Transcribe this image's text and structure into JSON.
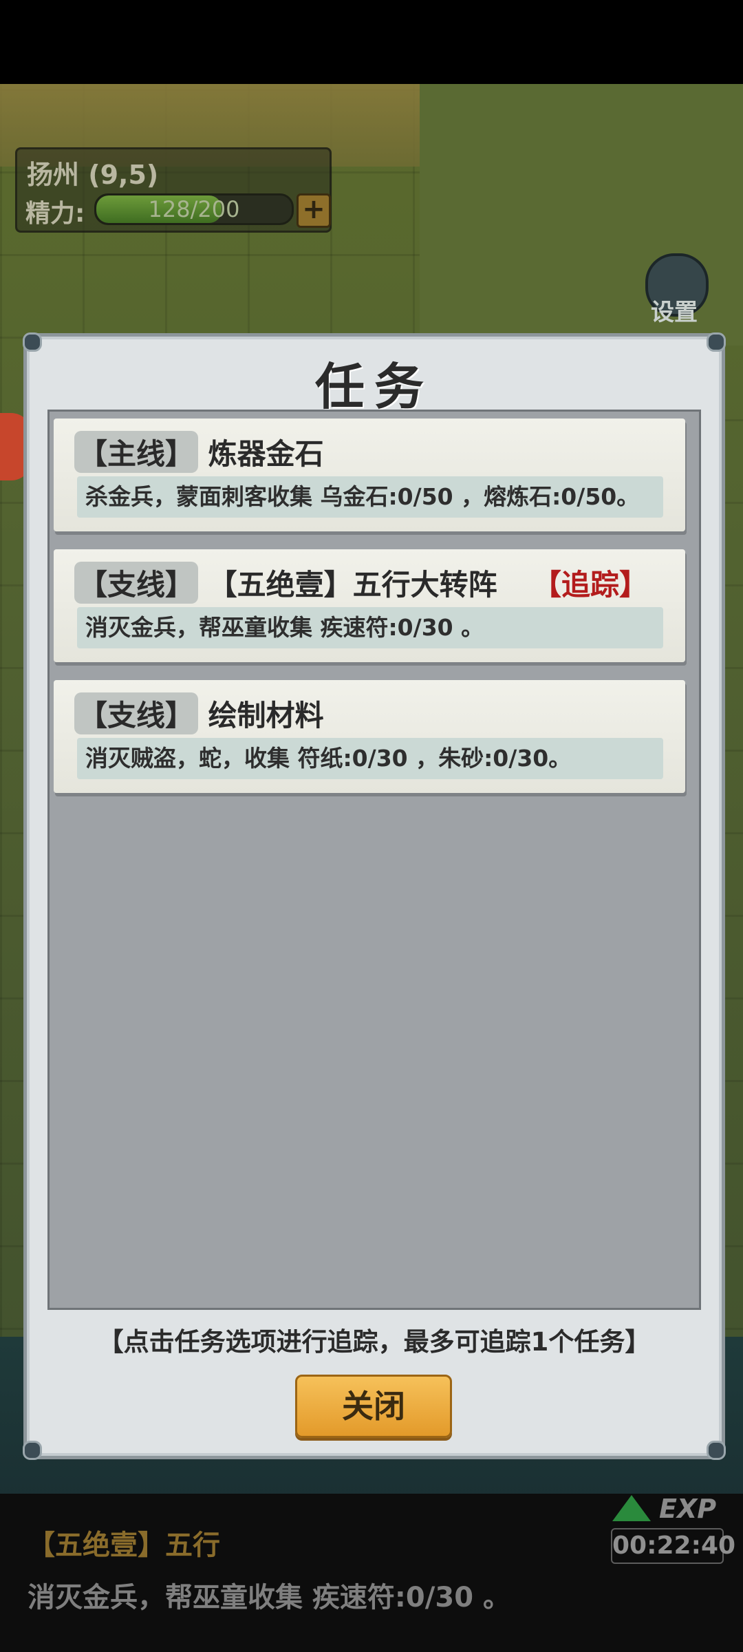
{
  "hud": {
    "location": "扬州 (9,5)",
    "energy_label": "精力:",
    "energy_value": "128/200",
    "energy_fraction": 0.64,
    "energy_plus": "+",
    "settings_label": "设置"
  },
  "dialog": {
    "title": "任务",
    "tasks": [
      {
        "tag": "【主线】",
        "title": "炼器金石",
        "track": "",
        "desc": "杀金兵，蒙面刺客收集 乌金石:0/50 ，熔炼石:0/50。"
      },
      {
        "tag": "【支线】",
        "title": "【五绝壹】五行大转阵",
        "track": "【追踪】",
        "desc": "消灭金兵，帮巫童收集 疾速符:0/30 。"
      },
      {
        "tag": "【支线】",
        "title": "绘制材料",
        "track": "",
        "desc": "消灭贼盗，蛇，收集 符纸:0/30 ，朱砂:0/30。"
      }
    ],
    "hint": "【点击任务选项进行追踪，最多可追踪1个任务】",
    "close_label": "关闭"
  },
  "bottom": {
    "quest_title": "【五绝壹】五行",
    "quest_desc": "消灭金兵，帮巫童收集 疾速符:0/30 。",
    "exp_label": "EXP",
    "timer": "00:22:40"
  }
}
